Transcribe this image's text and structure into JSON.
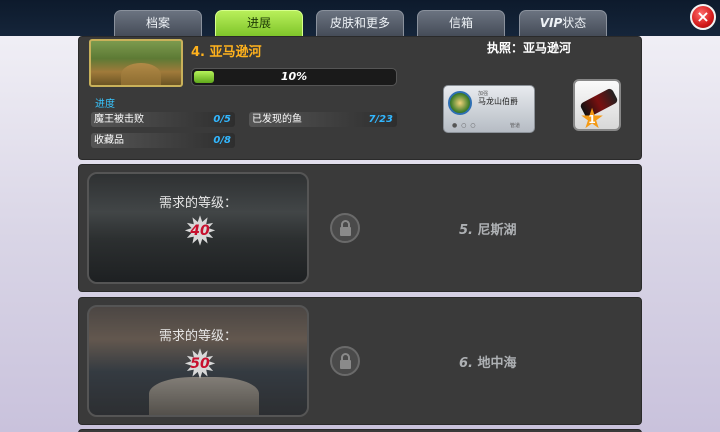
{
  "tabs": [
    {
      "label": "档案",
      "active": false
    },
    {
      "label": "进展",
      "active": true
    },
    {
      "label": "皮肤和更多",
      "active": false
    },
    {
      "label": "信箱",
      "active": false
    },
    {
      "label_prefix": "VIP",
      "label": "状态",
      "active": false
    }
  ],
  "close_icon": "×",
  "current_location": {
    "title": "4. 亚马逊河",
    "progress_percent": 10,
    "progress_text": "10%",
    "section_label": "进度",
    "stats": [
      {
        "label": "魔王被击败",
        "value": "0/5"
      },
      {
        "label": "已发现的鱼",
        "value": "7/23"
      },
      {
        "label": "收藏品",
        "value": "0/8"
      }
    ],
    "license": "执照：亚马逊河",
    "card": {
      "tag": "加强",
      "name": "马龙山伯爵",
      "dots": "● ○ ○",
      "more": "管道"
    },
    "gear_badge": "1"
  },
  "locked_locations": [
    {
      "required_label": "需求的等级：",
      "required_level": "40",
      "number": "5.",
      "name": "尼斯湖"
    },
    {
      "required_label": "需求的等级：",
      "required_level": "50",
      "number": "6.",
      "name": "地中海"
    }
  ],
  "colors": {
    "accent_green": "#8fd63a",
    "title_orange": "#ffb21d",
    "stat_blue": "#32b7ff",
    "level_red": "#c8102e"
  }
}
